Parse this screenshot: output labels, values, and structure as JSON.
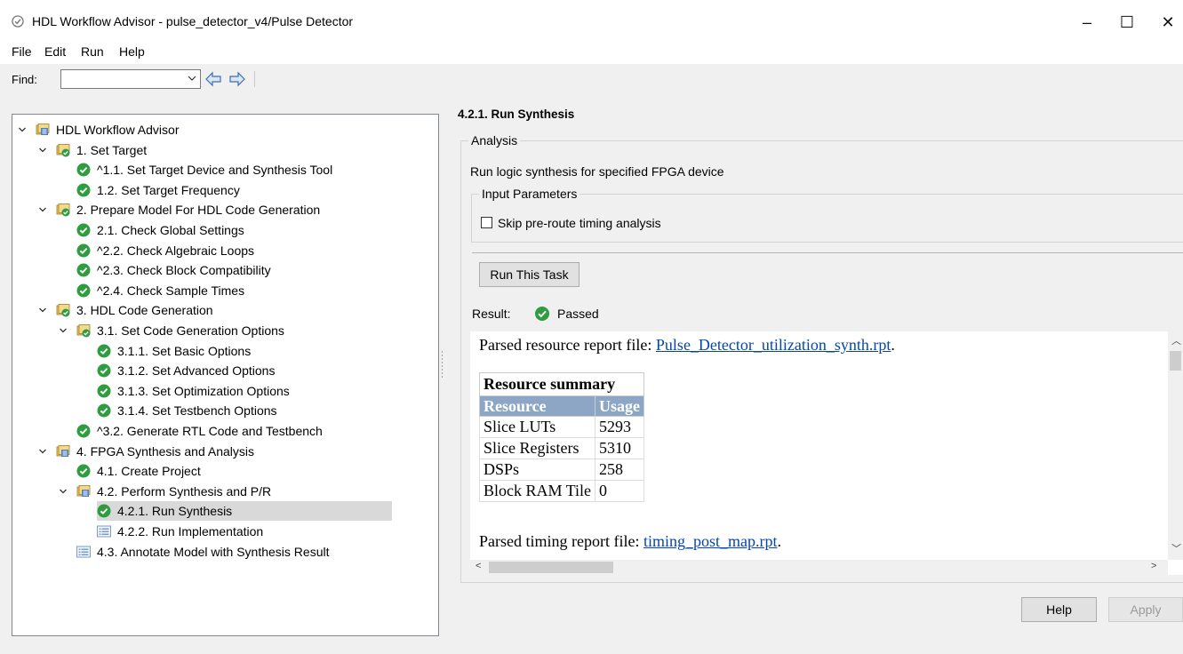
{
  "window": {
    "title": "HDL Workflow Advisor - pulse_detector_v4/Pulse Detector",
    "minimize": "–",
    "maximize": "☐",
    "close": "✕"
  },
  "menu": [
    "File",
    "Edit",
    "Run",
    "Help"
  ],
  "toolbar": {
    "find_label": "Find:",
    "find_value": ""
  },
  "tree": [
    {
      "label": "HDL Workflow Advisor"
    },
    {
      "label": "1. Set Target"
    },
    {
      "label": "^1.1. Set Target Device and Synthesis Tool"
    },
    {
      "label": "1.2. Set Target Frequency"
    },
    {
      "label": "2. Prepare Model For HDL Code Generation"
    },
    {
      "label": "2.1. Check Global Settings"
    },
    {
      "label": "^2.2. Check Algebraic Loops"
    },
    {
      "label": "^2.3. Check Block Compatibility"
    },
    {
      "label": "^2.4. Check Sample Times"
    },
    {
      "label": "3. HDL Code Generation"
    },
    {
      "label": "3.1. Set Code Generation Options"
    },
    {
      "label": "3.1.1. Set Basic Options"
    },
    {
      "label": "3.1.2. Set Advanced Options"
    },
    {
      "label": "3.1.3. Set Optimization Options"
    },
    {
      "label": "3.1.4. Set Testbench Options"
    },
    {
      "label": "^3.2. Generate RTL Code and Testbench"
    },
    {
      "label": "4. FPGA Synthesis and Analysis"
    },
    {
      "label": "4.1. Create Project"
    },
    {
      "label": "4.2. Perform Synthesis and P/R"
    },
    {
      "label": "4.2.1. Run Synthesis"
    },
    {
      "label": "4.2.2. Run Implementation"
    },
    {
      "label": "4.3. Annotate Model with Synthesis Result"
    }
  ],
  "task": {
    "title": "4.2.1. Run Synthesis",
    "analysis_title": "Analysis",
    "description": "Run logic synthesis for specified FPGA device",
    "input_params_title": "Input Parameters",
    "skip_label": "Skip pre-route timing analysis",
    "skip_checked": false,
    "run_button": "Run This Task",
    "result_label": "Result:",
    "result_value": "Passed"
  },
  "report": {
    "resource_prefix": "Parsed resource report file: ",
    "resource_link": "Pulse_Detector_utilization_synth.rpt",
    "resource_suffix": ".",
    "table_caption": "Resource summary",
    "headers": [
      "Resource",
      "Usage"
    ],
    "rows": [
      [
        "Slice LUTs",
        "5293"
      ],
      [
        "Slice Registers",
        "5310"
      ],
      [
        "DSPs",
        "258"
      ],
      [
        "Block RAM Tile",
        "0"
      ]
    ],
    "timing_prefix": "Parsed timing report file: ",
    "timing_link": "timing_post_map.rpt",
    "timing_suffix": "."
  },
  "footer": {
    "help": "Help",
    "apply": "Apply"
  },
  "colors": {
    "check_green": "#2e9c3f",
    "table_header": "#8ea6c6",
    "link": "#0645ad",
    "selection": "#d9d9d9"
  }
}
